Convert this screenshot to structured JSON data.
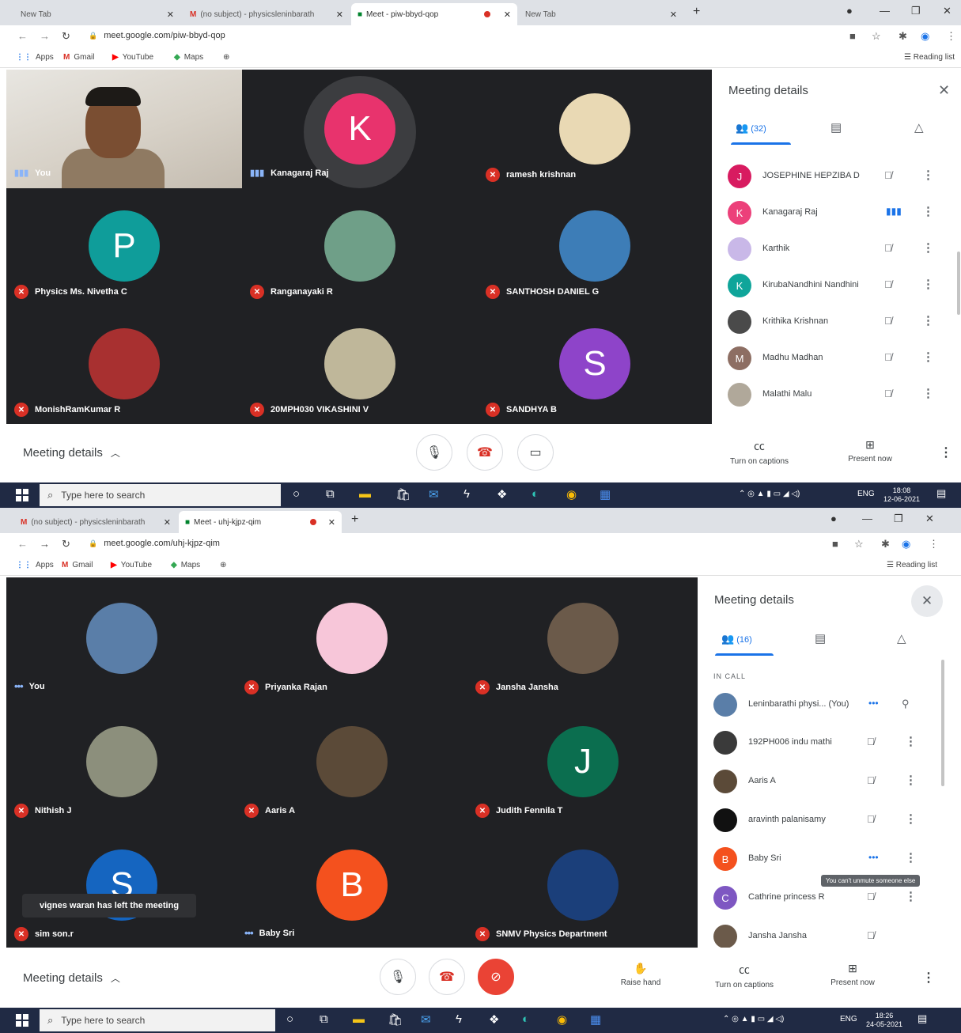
{
  "shotA": {
    "tabs": [
      "New Tab",
      "(no subject) - physicsleninbarath",
      "Meet - piw-bbyd-qop",
      "New Tab"
    ],
    "url": "meet.google.com/piw-bbyd-qop",
    "bookmarks": [
      "Apps",
      "Gmail",
      "YouTube",
      "Maps"
    ],
    "reading_list": "Reading list",
    "participants": [
      {
        "name": "You",
        "initial": "",
        "color": ""
      },
      {
        "name": "Kanagaraj Raj",
        "initial": "K",
        "color": "#e8336d"
      },
      {
        "name": "ramesh krishnan",
        "initial": "",
        "color": "#e9d9b4"
      },
      {
        "name": "Physics Ms. Nivetha C",
        "initial": "P",
        "color": "#0f9d9a"
      },
      {
        "name": "Ranganayaki R",
        "initial": "",
        "color": "#6f9f88"
      },
      {
        "name": "SANTHOSH DANIEL G",
        "initial": "",
        "color": "#3d7db7"
      },
      {
        "name": "MonishRamKumar R",
        "initial": "",
        "color": "#a83030"
      },
      {
        "name": "20MPH030 VIKASHINI V",
        "initial": "",
        "color": "#bfb79a"
      },
      {
        "name": "SANDHYA B",
        "initial": "S",
        "color": "#8e44c9"
      }
    ],
    "panel": {
      "title": "Meeting details",
      "people_count": "(32)",
      "rows": [
        {
          "initial": "J",
          "name": "JOSEPHINE HEPZIBA D",
          "color": "#d81b60"
        },
        {
          "initial": "K",
          "name": "Kanagaraj Raj",
          "color": "#ec407a"
        },
        {
          "initial": "",
          "name": "Karthik",
          "color": "#c9b8e8"
        },
        {
          "initial": "K",
          "name": "KirubaNandhini Nandhini",
          "color": "#0fa59a"
        },
        {
          "initial": "",
          "name": "Krithika Krishnan",
          "color": "#4a4a4a"
        },
        {
          "initial": "M",
          "name": "Madhu Madhan",
          "color": "#8d6e63"
        },
        {
          "initial": "",
          "name": "Malathi Malu",
          "color": "#b0a89a"
        }
      ]
    },
    "controls": {
      "meeting_details": "Meeting details",
      "captions": "Turn on captions",
      "present": "Present now"
    },
    "taskbar": {
      "search": "Type here to search",
      "lang": "ENG",
      "time": "18:08",
      "date": "12-06-2021"
    }
  },
  "shotB": {
    "tabs": [
      "(no subject) - physicsleninbarath",
      "Meet - uhj-kjpz-qim"
    ],
    "url": "meet.google.com/uhj-kjpz-qim",
    "bookmarks": [
      "Apps",
      "Gmail",
      "YouTube",
      "Maps"
    ],
    "reading_list": "Reading list",
    "participants": [
      {
        "name": "You",
        "initial": "",
        "color": "#5a7ea8"
      },
      {
        "name": "Priyanka Rajan",
        "initial": "",
        "color": "#f7c6d9"
      },
      {
        "name": "Jansha Jansha",
        "initial": "",
        "color": "#6b5a4a"
      },
      {
        "name": "Nithish J",
        "initial": "",
        "color": "#8c8f7c"
      },
      {
        "name": "Aaris A",
        "initial": "",
        "color": "#5b4a38"
      },
      {
        "name": "Judith Fennila T",
        "initial": "J",
        "color": "#0b6e4f"
      },
      {
        "name": "sim son.r",
        "initial": "S",
        "color": "#1565c0"
      },
      {
        "name": "Baby Sri",
        "initial": "B",
        "color": "#f4511e"
      },
      {
        "name": "SNMV Physics Department",
        "initial": "",
        "color": "#1b3f7a"
      }
    ],
    "toast": "vignes waran has left the meeting",
    "panel": {
      "title": "Meeting details",
      "people_count": "(16)",
      "section": "IN CALL",
      "rows": [
        {
          "initial": "",
          "name": "Leninbarathi physi... (You)",
          "color": "#5a7ea8"
        },
        {
          "initial": "",
          "name": "192PH006 indu mathi",
          "color": "#3a3a3a"
        },
        {
          "initial": "",
          "name": "Aaris A",
          "color": "#5b4a38"
        },
        {
          "initial": "",
          "name": "aravinth palanisamy",
          "color": "#111111"
        },
        {
          "initial": "B",
          "name": "Baby Sri",
          "color": "#f4511e"
        },
        {
          "initial": "C",
          "name": "Cathrine princess R",
          "color": "#7e57c2"
        },
        {
          "initial": "",
          "name": "Jansha Jansha",
          "color": "#6b5a4a"
        }
      ],
      "tooltip": "You can't unmute someone else"
    },
    "controls": {
      "meeting_details": "Meeting details",
      "raise_hand": "Raise hand",
      "captions": "Turn on captions",
      "present": "Present now"
    },
    "taskbar": {
      "search": "Type here to search",
      "lang": "ENG",
      "time": "18:26",
      "date": "24-05-2021"
    }
  }
}
